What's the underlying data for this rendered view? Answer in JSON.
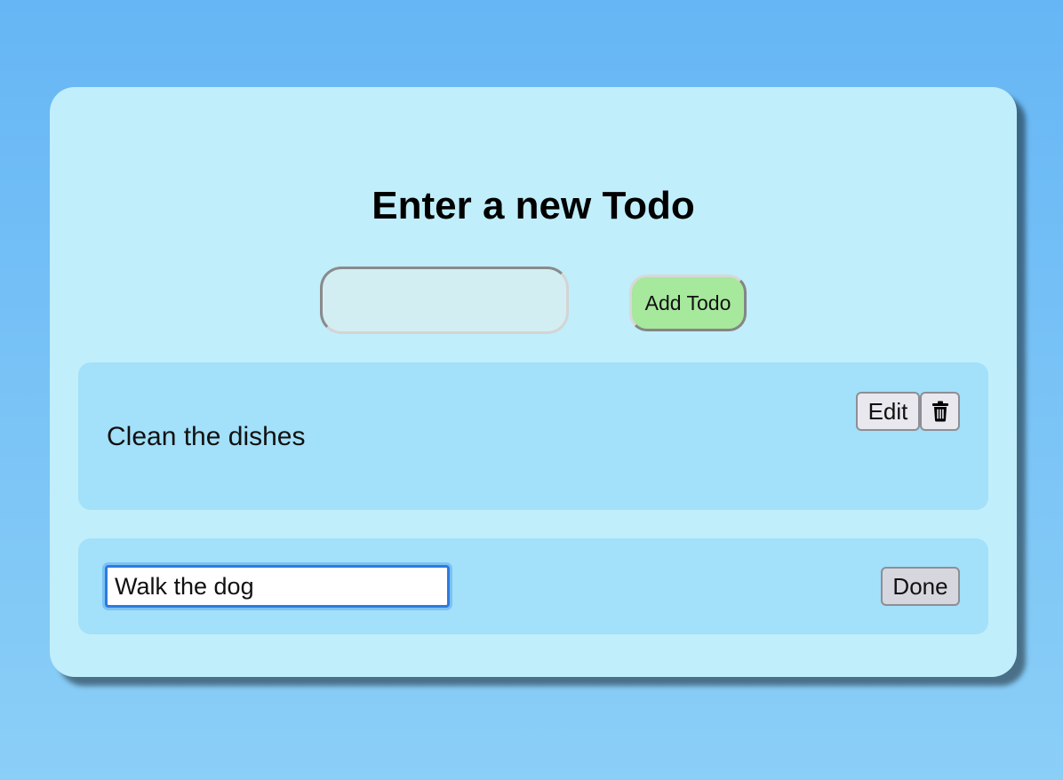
{
  "form": {
    "title": "Enter a new Todo",
    "new_todo_value": "",
    "add_button_label": "Add Todo"
  },
  "todos": [
    {
      "text": "Clean the dishes",
      "mode": "view",
      "edit_label": "Edit",
      "delete_icon": "trash-icon"
    },
    {
      "text": "Walk the dog",
      "mode": "editing",
      "done_label": "Done"
    }
  ],
  "colors": {
    "background": "#66b6f5",
    "card": "#c0eefb",
    "item": "#a3e0f9",
    "add_button": "#a6e89c",
    "focus_ring": "#2d7be0"
  }
}
